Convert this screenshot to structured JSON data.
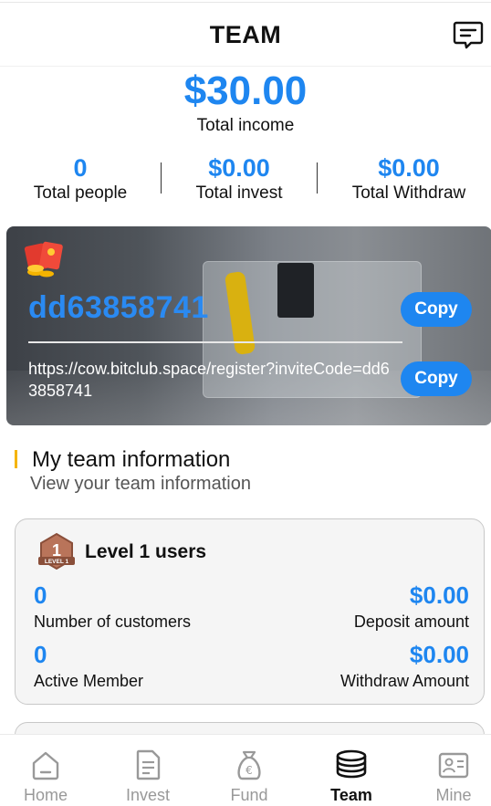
{
  "header": {
    "title": "TEAM",
    "message_icon": "message-icon"
  },
  "summary": {
    "total_income_value": "$30.00",
    "total_income_label": "Total income"
  },
  "stats": [
    {
      "value": "0",
      "label": "Total people"
    },
    {
      "value": "$0.00",
      "label": "Total invest"
    },
    {
      "value": "$0.00",
      "label": "Total Withdraw"
    }
  ],
  "invite": {
    "code": "dd63858741",
    "link": "https://cow.bitclub.space/register?inviteCode=dd63858741",
    "copy_label": "Copy",
    "icon": "red-envelope-icon"
  },
  "team_section": {
    "title": "My team information",
    "subtitle": "View your team information"
  },
  "level1": {
    "title": "Level 1 users",
    "badge_text": "LEVEL 1",
    "customers_value": "0",
    "customers_label": "Number of customers",
    "deposit_value": "$0.00",
    "deposit_label": "Deposit amount",
    "active_value": "0",
    "active_label": "Active Member",
    "withdraw_value": "$0.00",
    "withdraw_label": "Withdraw Amount"
  },
  "tabs": [
    {
      "label": "Home",
      "icon": "home-icon",
      "active": false
    },
    {
      "label": "Invest",
      "icon": "document-icon",
      "active": false
    },
    {
      "label": "Fund",
      "icon": "money-bag-icon",
      "active": false
    },
    {
      "label": "Team",
      "icon": "coin-stack-icon",
      "active": true
    },
    {
      "label": "Mine",
      "icon": "id-card-icon",
      "active": false
    }
  ],
  "colors": {
    "accent": "#1e86f0",
    "section_bar": "#f5b400",
    "active_tab": "#111111",
    "inactive_tab": "#999999"
  }
}
